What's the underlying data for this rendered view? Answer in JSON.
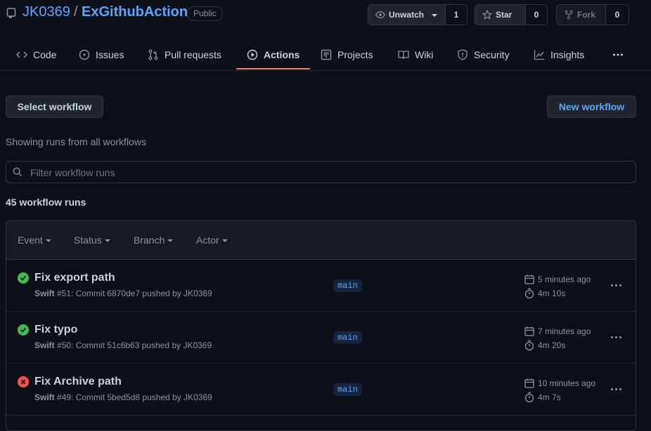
{
  "repo": {
    "owner": "JK0369",
    "separator": "/",
    "name": "ExGithubAction",
    "visibility": "Public"
  },
  "actions": {
    "watch": {
      "label": "Unwatch",
      "count": "1"
    },
    "star": {
      "label": "Star",
      "count": "0"
    },
    "fork": {
      "label": "Fork",
      "count": "0"
    }
  },
  "tabs": [
    {
      "label": "Code",
      "icon": "code-icon"
    },
    {
      "label": "Issues",
      "icon": "issue-icon"
    },
    {
      "label": "Pull requests",
      "icon": "pull-request-icon"
    },
    {
      "label": "Actions",
      "icon": "play-icon",
      "selected": true
    },
    {
      "label": "Projects",
      "icon": "project-icon"
    },
    {
      "label": "Wiki",
      "icon": "book-icon"
    },
    {
      "label": "Security",
      "icon": "shield-icon"
    },
    {
      "label": "Insights",
      "icon": "graph-icon"
    }
  ],
  "main": {
    "select_workflow": "Select workflow",
    "new_workflow": "New workflow",
    "subtitle": "Showing runs from all workflows",
    "filter_placeholder": "Filter workflow runs",
    "runs_count": "45 workflow runs"
  },
  "filters": {
    "event": "Event",
    "status": "Status",
    "branch": "Branch",
    "actor": "Actor"
  },
  "runs": [
    {
      "status": "success",
      "title": "Fix export path",
      "workflow": "Swift",
      "meta": "#51: Commit 6870de7 pushed by JK0369",
      "branch": "main",
      "when": "5 minutes ago",
      "duration": "4m 10s"
    },
    {
      "status": "success",
      "title": "Fix typo",
      "workflow": "Swift",
      "meta": "#50: Commit 51c6b63 pushed by JK0369",
      "branch": "main",
      "when": "7 minutes ago",
      "duration": "4m 20s"
    },
    {
      "status": "failure",
      "title": "Fix Archive path",
      "workflow": "Swift",
      "meta": "#49: Commit 5bed5d8 pushed by JK0369",
      "branch": "main",
      "when": "10 minutes ago",
      "duration": "4m 7s"
    }
  ],
  "colors": {
    "background": "#0d1117",
    "accent_link": "#58a6ff",
    "tab_underline": "#f78166",
    "success": "#3fb950",
    "failure": "#f85149"
  }
}
